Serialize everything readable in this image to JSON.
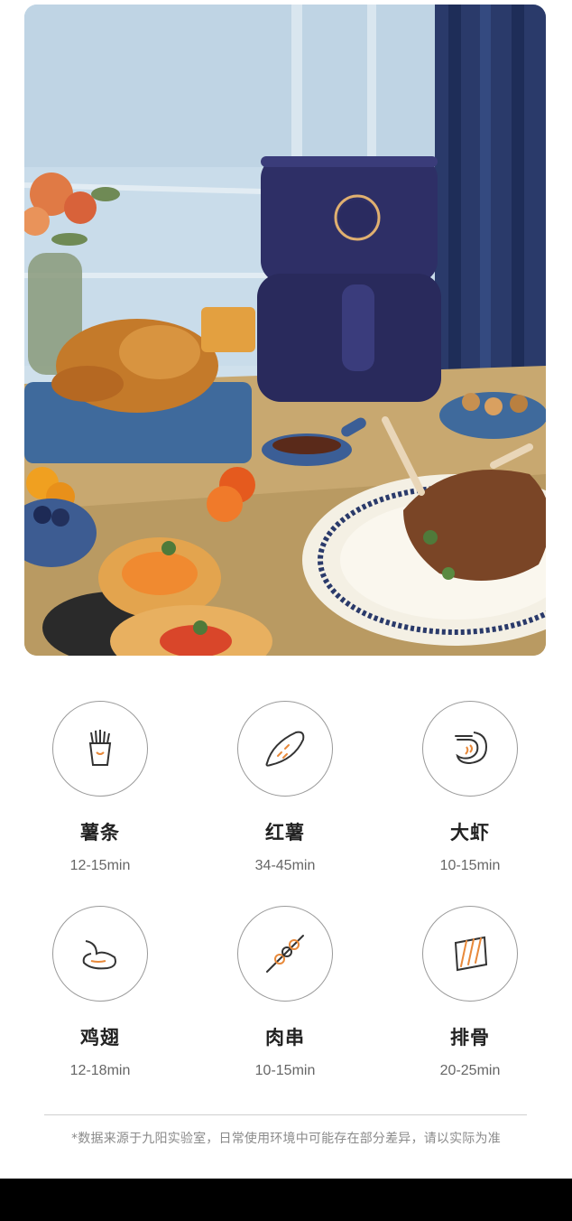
{
  "foods": [
    {
      "name": "薯条",
      "time": "12-15min",
      "icon": "fries-icon"
    },
    {
      "name": "红薯",
      "time": "34-45min",
      "icon": "sweet-potato-icon"
    },
    {
      "name": "大虾",
      "time": "10-15min",
      "icon": "shrimp-icon"
    },
    {
      "name": "鸡翅",
      "time": "12-18min",
      "icon": "chicken-wing-icon"
    },
    {
      "name": "肉串",
      "time": "10-15min",
      "icon": "skewer-icon"
    },
    {
      "name": "排骨",
      "time": "20-25min",
      "icon": "ribs-icon"
    }
  ],
  "footnote": "*数据来源于九阳实验室，日常使用环境中可能存在部分差异，请以实际为准",
  "colors": {
    "accent": "#e8893a",
    "icon_stroke": "#333333",
    "circle_border": "#9a9a9a",
    "appliance": "#2e2f66"
  }
}
